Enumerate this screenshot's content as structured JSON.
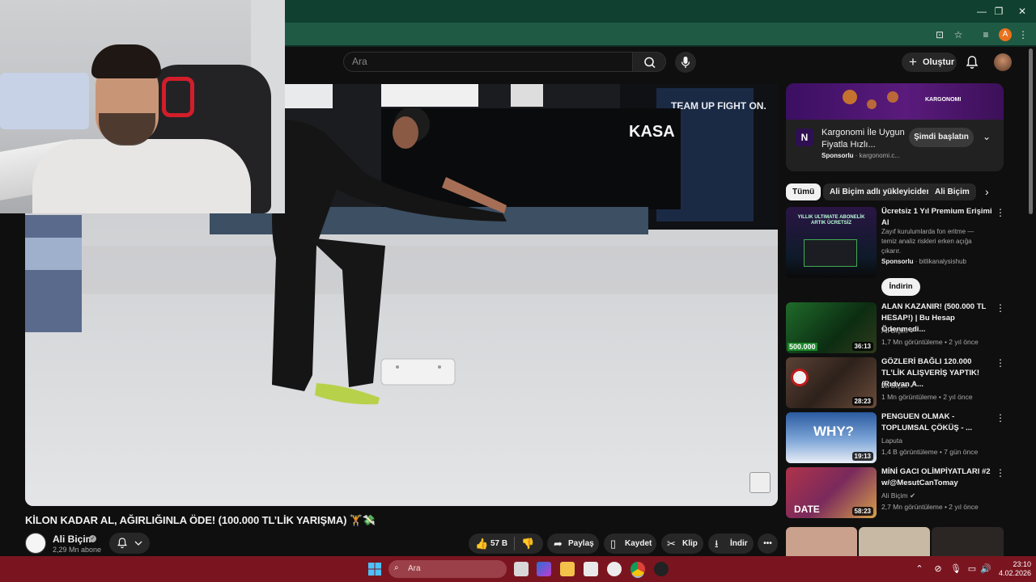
{
  "search": {
    "placeholder": "Ara"
  },
  "header": {
    "create_label": "Oluştur"
  },
  "video": {
    "title": "KİLON KADAR AL, AĞIRLIĞINLA ÖDE! (100.000 TL’LİK YARIŞMA) 🏋️💸",
    "scene_sign": "KASA",
    "scene_banner": "TEAM UP FIGHT ON."
  },
  "channel": {
    "name": "Ali Biçim",
    "subscribers": "2,29 Mn abone"
  },
  "actions": {
    "likes": "57 B",
    "share": "Paylaş",
    "save": "Kaydet",
    "clip": "Klip",
    "download": "İndir"
  },
  "ad": {
    "brand_banner": "KARGONOMI",
    "logo_letter": "N",
    "title": "Kargonomi İle Uygun Fiyatla Hızlı...",
    "sponsor_label": "Sponsorlu",
    "domain": "kargonomi.c...",
    "cta": "Şimdi başlatın"
  },
  "chips": [
    "Tümü",
    "Ali Biçim adlı yükleyiciden",
    "Ali Biçim"
  ],
  "recommendations": [
    {
      "title": "Ücretsiz 1 Yıl Premium Erişimi Al",
      "desc": "Zayıf kurulumlarda fon eritme — temiz analiz riskleri erken açığa çıkarır.",
      "sponsor": "Sponsorlu",
      "channel": "bitlikanalysishub",
      "cta": "İndirin",
      "thumb_text": "YILLIK ULTIMATE ABONELİK ARTIK ÜCRETSİZ"
    },
    {
      "title": "ALAN KAZANIR! (500.000 TL HESAP!) | Bu Hesap Ödenmedi...",
      "channel": "Ali Biçim",
      "meta": "1,7 Mn görüntüleme • 2 yıl önce",
      "duration": "36:13",
      "thumb_text": "500.000"
    },
    {
      "title": "GÖZLERİ BAĞLI 120.000 TL’LİK ALIŞVERİŞ YAPTIK! (Rıdvan A...",
      "channel": "Ali Biçim",
      "meta": "1 Mn görüntüleme • 2 yıl önce",
      "duration": "28:23"
    },
    {
      "title": "PENGUEN OLMAK - TOPLUMSAL ÇÖKÜŞ - ...",
      "channel": "Laputa",
      "meta": "1,4 B görüntüleme • 7 gün önce",
      "duration": "19:13",
      "thumb_text": "WHY?"
    },
    {
      "title": "MİNİ GACI OLİMPİYATLARI #2 w/@MesutCanTomay",
      "channel": "Ali Biçim",
      "meta": "2,7 Mn görüntüleme • 2 yıl önce",
      "duration": "58:23",
      "thumb_text": "DATE"
    }
  ],
  "taskbar": {
    "search_placeholder": "Ara",
    "time": "23:10",
    "date": "4.02.2026"
  },
  "browser": {
    "profile_initial": "A"
  },
  "colors": {
    "titlebar": "#10402f",
    "toolbar": "#1f5a45",
    "taskbar": "#7a1520",
    "yt_bg": "#0f0f0f"
  }
}
